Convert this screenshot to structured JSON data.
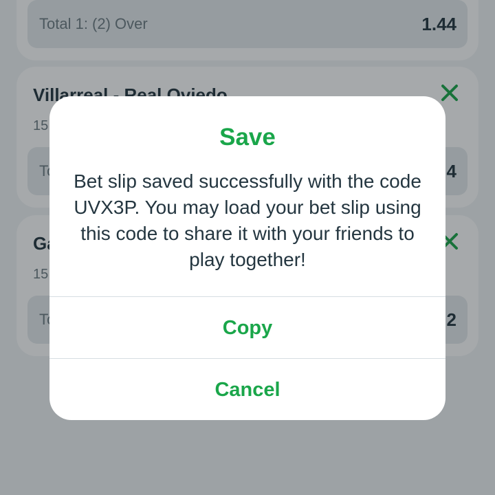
{
  "slip": {
    "cards": [
      {
        "market_label": "Total 1: (2) Over",
        "odds": "1.44"
      },
      {
        "match_title": "Villarreal - Real Oviedo",
        "date": "15",
        "market_label": "To",
        "odds": "4"
      },
      {
        "match_title": "Ga",
        "date": "15",
        "market_label": "To",
        "odds": "2"
      }
    ]
  },
  "dialog": {
    "title": "Save",
    "message": "Bet slip saved successfully with the code UVX3P. You may load your bet slip using this code to share it with your friends to play together!",
    "copy_label": "Copy",
    "cancel_label": "Cancel"
  },
  "colors": {
    "accent_green": "#1aa64a",
    "text_dark": "#243640",
    "card_background": "#ffffff",
    "market_background": "#e6ebee"
  },
  "icons": {
    "remove": "close-icon"
  }
}
